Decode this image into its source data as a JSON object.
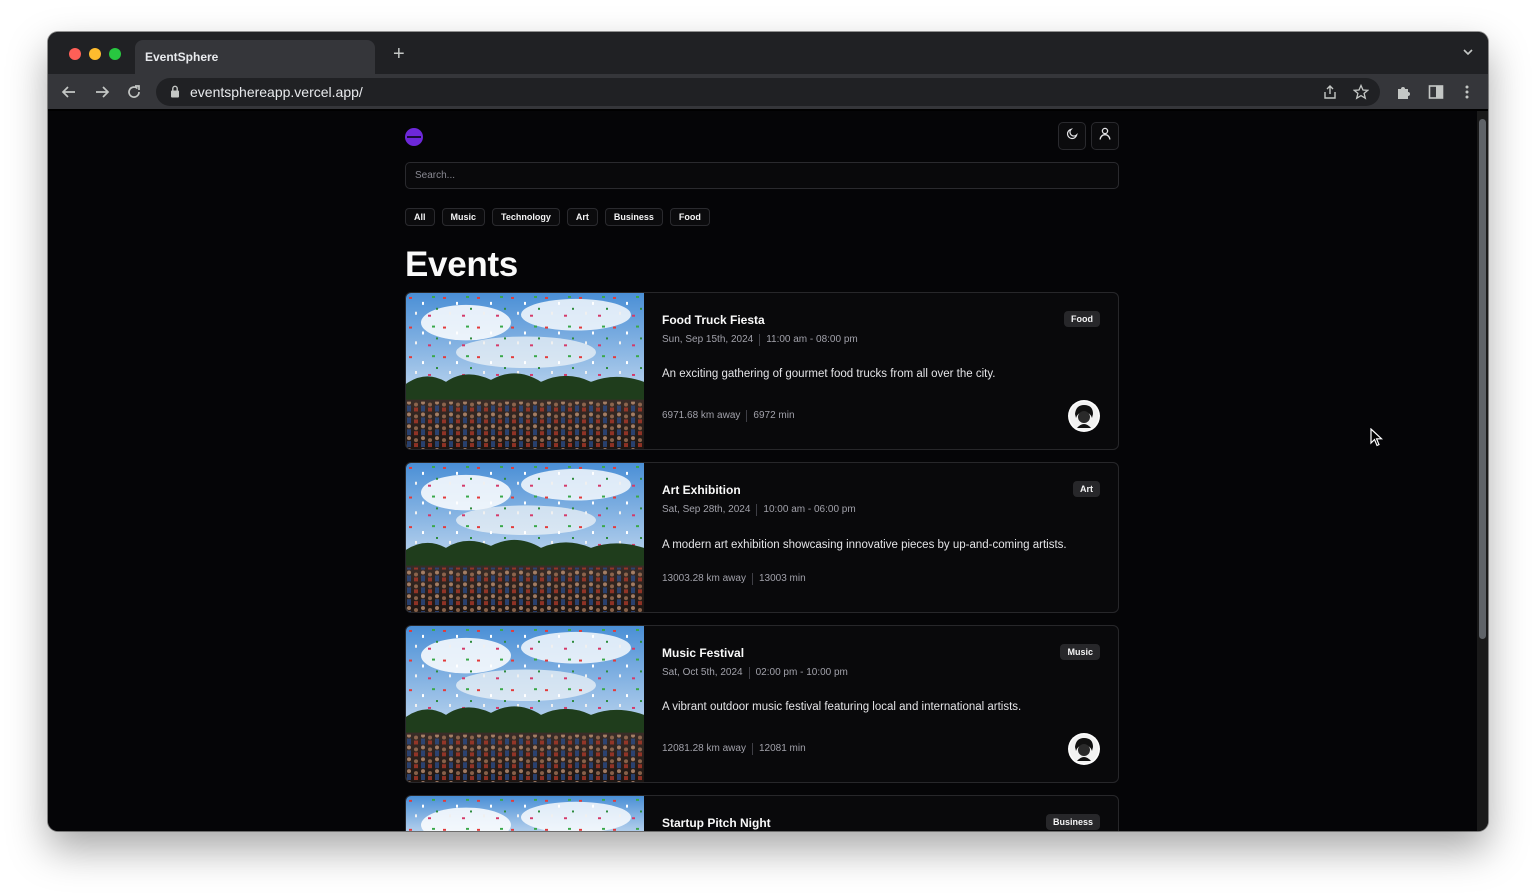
{
  "browser": {
    "tab_title": "EventSphere",
    "new_tab_symbol": "+",
    "url": "eventsphereapp.vercel.app/"
  },
  "app": {
    "search_placeholder": "Search...",
    "filters": [
      "All",
      "Music",
      "Technology",
      "Art",
      "Business",
      "Food"
    ],
    "page_title": "Events"
  },
  "events": [
    {
      "title": "Food Truck Fiesta",
      "date": "Sun, Sep 15th, 2024",
      "time": "11:00 am - 08:00 pm",
      "description": "An exciting gathering of gourmet food trucks from all over the city.",
      "distance": "6971.68 km away",
      "duration": "6972 min",
      "category": "Food",
      "has_avatar": true
    },
    {
      "title": "Art Exhibition",
      "date": "Sat, Sep 28th, 2024",
      "time": "10:00 am - 06:00 pm",
      "description": "A modern art exhibition showcasing innovative pieces by up-and-coming artists.",
      "distance": "13003.28 km away",
      "duration": "13003 min",
      "category": "Art",
      "has_avatar": false
    },
    {
      "title": "Music Festival",
      "date": "Sat, Oct 5th, 2024",
      "time": "02:00 pm - 10:00 pm",
      "description": "A vibrant outdoor music festival featuring local and international artists.",
      "distance": "12081.28 km away",
      "duration": "12081 min",
      "category": "Music",
      "has_avatar": true
    },
    {
      "title": "Startup Pitch Night",
      "category": "Business"
    }
  ],
  "icons": {
    "logo": "eventsphere-logo-icon",
    "theme_toggle": "moon-icon",
    "account": "user-icon"
  },
  "colors": {
    "brand": "#6d28d9",
    "background": "#050507",
    "card_border": "#27272a"
  }
}
